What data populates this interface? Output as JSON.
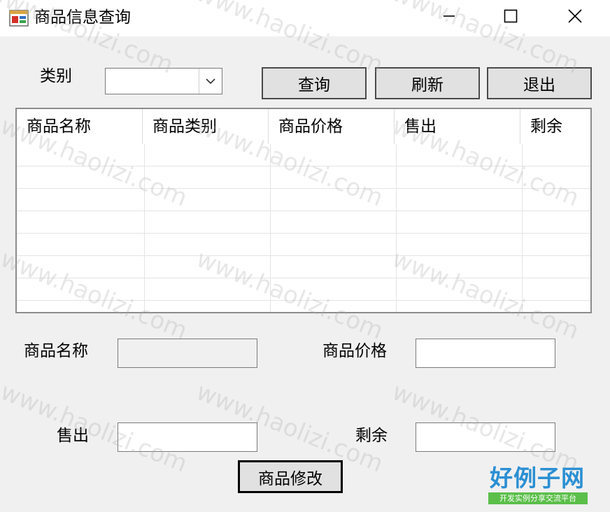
{
  "window": {
    "title": "商品信息查询"
  },
  "titlebar_icons": {
    "minimize": "minimize-icon",
    "maximize": "maximize-icon",
    "close": "close-icon"
  },
  "filter": {
    "category_label": "类别",
    "category_value": ""
  },
  "toolbar": {
    "query_label": "查询",
    "refresh_label": "刷新",
    "exit_label": "退出"
  },
  "grid": {
    "columns": [
      "商品名称",
      "商品类别",
      "商品价格",
      "售出",
      "剩余"
    ],
    "rows": []
  },
  "form": {
    "name_label": "商品名称",
    "name_value": "",
    "price_label": "商品价格",
    "price_value": "",
    "sold_label": "售出",
    "sold_value": "",
    "remain_label": "剩余",
    "remain_value": "",
    "modify_label": "商品修改"
  },
  "watermark": {
    "text": "www.haolizi.com"
  },
  "brand": {
    "name": "好例子网",
    "tagline": "开发实例分享交流平台"
  },
  "colors": {
    "background": "#f0f0f0",
    "titlebar": "#ffffff",
    "brand_blue": "#2b8fd3",
    "brand_green": "#5bbf4a"
  }
}
